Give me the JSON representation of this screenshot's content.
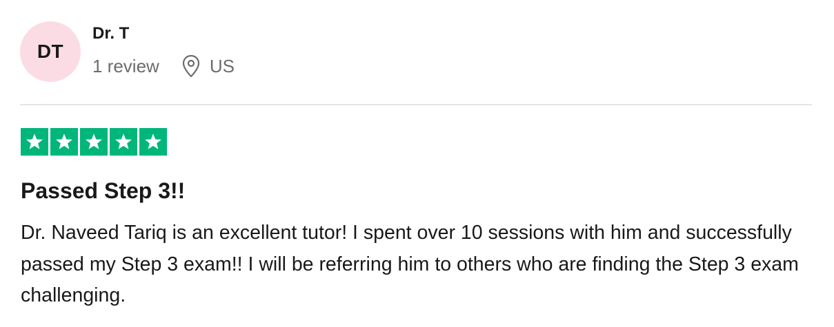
{
  "reviewer": {
    "initials": "DT",
    "avatar_color": "#fcdce4",
    "name": "Dr. T",
    "review_count": "1 review",
    "location_icon": "location-pin-icon",
    "location": "US"
  },
  "rating": {
    "stars": 5,
    "max_stars": 5,
    "star_color": "#00b67a",
    "icon": "star-icon"
  },
  "review": {
    "title": "Passed Step 3!!",
    "body": "Dr. Naveed Tariq is an excellent tutor! I spent over 10 sessions with him and successfully passed my Step 3 exam!! I will be referring him to others who are finding the Step 3 exam challenging."
  }
}
